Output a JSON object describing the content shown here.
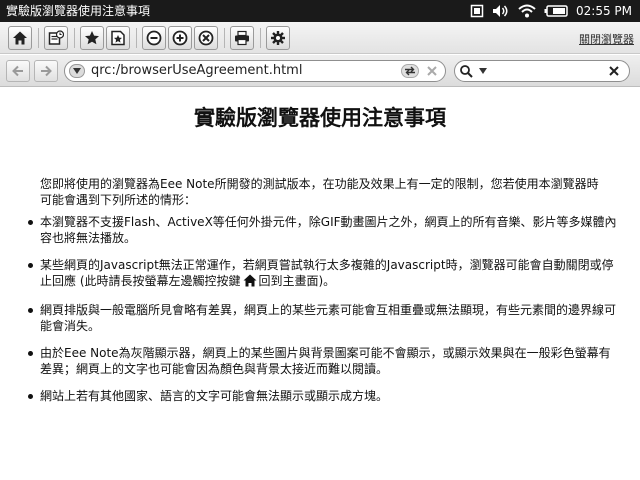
{
  "statusbar": {
    "title": "實驗版瀏覽器使用注意事項",
    "clock": "02:55 PM",
    "icons": [
      "tablet-icon",
      "volume-icon",
      "wifi-icon",
      "battery-icon"
    ]
  },
  "toolbar": {
    "buttons": [
      "home-icon",
      "history-icon",
      "bookmark-icon",
      "add-bookmark-icon",
      "zoom-out-icon",
      "zoom-in-icon",
      "zoom-reset-icon",
      "print-icon",
      "settings-icon"
    ],
    "close_browser": "關閉瀏覽器"
  },
  "address": {
    "url": "qrc:/browserUseAgreement.html"
  },
  "page": {
    "title": "實驗版瀏覽器使用注意事項",
    "intro": "您即將使用的瀏覽器為Eee Note所開發的測試版本，在功能及效果上有一定的限制，您若使用本瀏覽器時可能會遇到下列所述的情形：",
    "items": [
      "本瀏覽器不支援Flash、ActiveX等任何外掛元件，除GIF動畫圖片之外，網頁上的所有音樂、影片等多媒體內容也將無法播放。",
      "某些網頁的Javascript無法正常運作，若網頁嘗試執行太多複雜的Javascript時，瀏覽器可能會自動關閉或停止回應 (此時請長按螢幕左邊觸控按鍵",
      "網頁排版與一般電腦所見會略有差異，網頁上的某些元素可能會互相重疊或無法顯現，有些元素間的邊界線可能會消失。",
      "由於Eee Note為灰階顯示器，網頁上的某些圖片與背景圖案可能不會顯示，或顯示效果與在一般彩色螢幕有差異；網頁上的文字也可能會因為顏色與背景太接近而難以閱讀。",
      "網站上若有其他國家、語言的文字可能會無法顯示或顯示成方塊。"
    ],
    "item2_suffix": "回到主畫面)。"
  }
}
